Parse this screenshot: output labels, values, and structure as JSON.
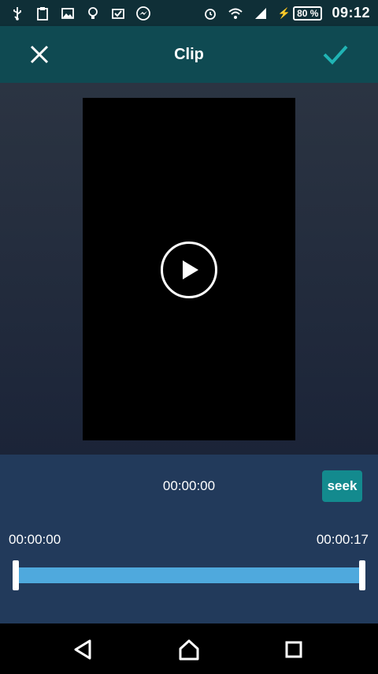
{
  "status_bar": {
    "battery": "80 %",
    "time": "09:12",
    "icons": [
      "usb-icon",
      "clipboard-icon",
      "image-icon",
      "bulb-icon",
      "mail-check-icon",
      "messenger-icon",
      "alarm-icon",
      "wifi-icon",
      "signal-icon",
      "charging-icon"
    ]
  },
  "app_bar": {
    "title": "Clip",
    "close_icon": "close-icon",
    "confirm_icon": "check-icon"
  },
  "video": {
    "play_icon": "play-icon"
  },
  "controls": {
    "current_time": "00:00:00",
    "seek_label": "seek",
    "start_time": "00:00:00",
    "end_time": "00:00:17",
    "selection_fraction": 1.0
  },
  "nav_bar": {
    "back_icon": "back-icon",
    "home_icon": "home-icon",
    "recent_icon": "recent-apps-icon"
  },
  "colors": {
    "status_bar": "#0f2f37",
    "app_bar": "#0f4a52",
    "accent": "#20b4b4",
    "seek_button": "#138a8e",
    "timeline": "#4fa9dd",
    "panel": "#223a5b"
  }
}
